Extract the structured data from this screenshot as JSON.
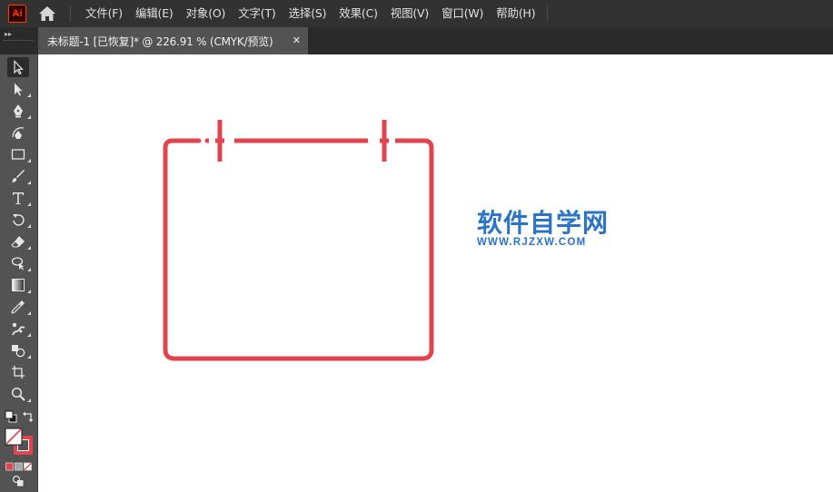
{
  "app": {
    "logo_text": "Ai",
    "logo_color": "#ff3d00"
  },
  "menu": {
    "items": [
      {
        "label": "文件(F)"
      },
      {
        "label": "编辑(E)"
      },
      {
        "label": "对象(O)"
      },
      {
        "label": "文字(T)"
      },
      {
        "label": "选择(S)"
      },
      {
        "label": "效果(C)"
      },
      {
        "label": "视图(V)"
      },
      {
        "label": "窗口(W)"
      },
      {
        "label": "帮助(H)"
      }
    ]
  },
  "document_tab": {
    "title": "未标题-1 [已恢复]* @ 226.91 % (CMYK/预览)",
    "close_glyph": "✕",
    "collapse_glyph": "▸▸"
  },
  "toolbar": {
    "tools": [
      {
        "name": "selection-tool",
        "icon": "arrow-icon",
        "active": true
      },
      {
        "name": "direct-selection-tool",
        "icon": "white-arrow-icon"
      },
      {
        "name": "pen-tool",
        "icon": "pen-icon"
      },
      {
        "name": "curvature-tool",
        "icon": "curvature-pen-icon"
      },
      {
        "name": "rectangle-tool",
        "icon": "rectangle-icon"
      },
      {
        "name": "paintbrush-tool",
        "icon": "brush-icon"
      },
      {
        "name": "type-tool",
        "icon": "type-icon"
      },
      {
        "name": "rotate-tool",
        "icon": "rotate-icon"
      },
      {
        "name": "eraser-tool",
        "icon": "eraser-icon"
      },
      {
        "name": "lasso-tool",
        "icon": "lasso-icon"
      },
      {
        "name": "gradient-tool",
        "icon": "gradient-icon"
      },
      {
        "name": "eyedropper-tool",
        "icon": "eyedropper-icon"
      },
      {
        "name": "puppet-warp-tool",
        "icon": "puppet-warp-icon"
      },
      {
        "name": "shape-builder-tool",
        "icon": "shape-builder-icon"
      },
      {
        "name": "artboard-tool",
        "icon": "artboard-icon"
      },
      {
        "name": "zoom-tool",
        "icon": "zoom-icon"
      }
    ],
    "fill_color": "#ffffff",
    "stroke_color": "#e2444f"
  },
  "artwork": {
    "stroke_color": "#e2444f"
  },
  "watermark": {
    "title": "软件自学网",
    "url": "WWW.RJZXW.COM",
    "color": "#2a74c8"
  }
}
